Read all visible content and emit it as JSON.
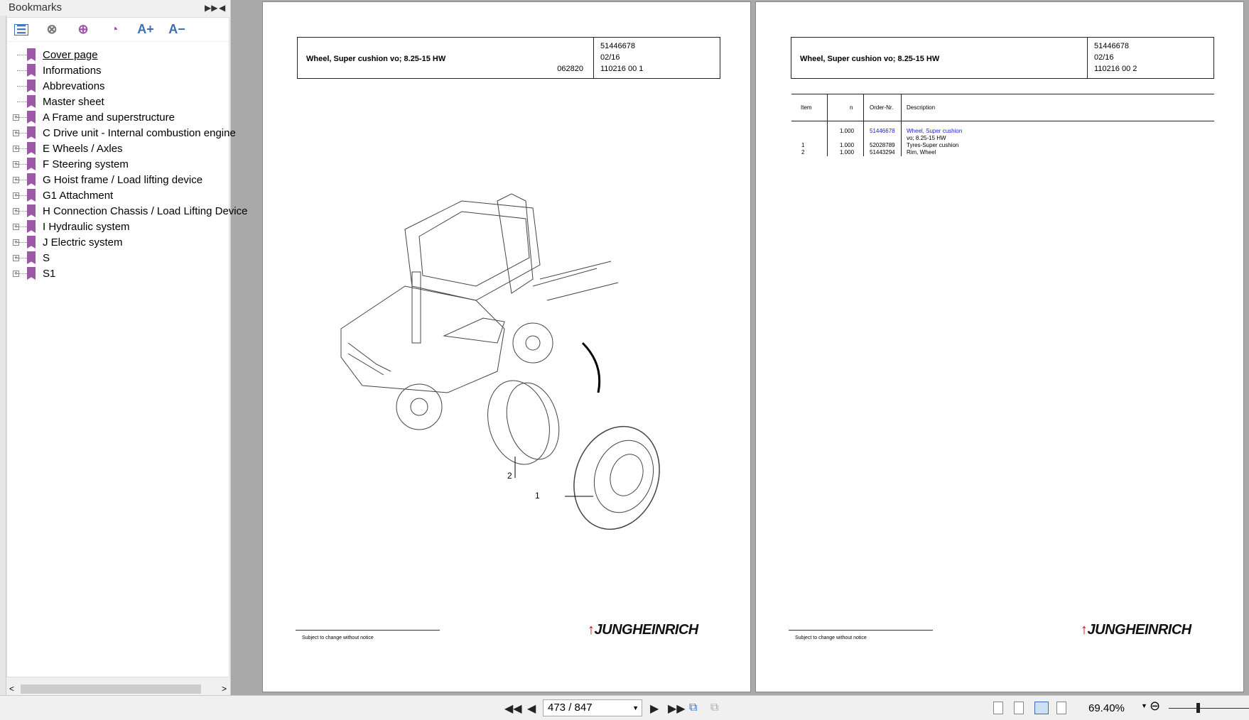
{
  "sidebar": {
    "title": "Bookmarks",
    "items": [
      {
        "label": "Cover page",
        "expandable": false
      },
      {
        "label": "Informations",
        "expandable": false
      },
      {
        "label": "Abbrevations",
        "expandable": false
      },
      {
        "label": "Master sheet",
        "expandable": false
      },
      {
        "label": "A Frame and superstructure",
        "expandable": true
      },
      {
        "label": "C Drive unit - Internal combustion engine",
        "expandable": true
      },
      {
        "label": "E Wheels / Axles",
        "expandable": true
      },
      {
        "label": "F Steering system",
        "expandable": true
      },
      {
        "label": "G Hoist frame / Load lifting device",
        "expandable": true
      },
      {
        "label": "G1 Attachment",
        "expandable": true
      },
      {
        "label": "H Connection Chassis / Load Lifting Device",
        "expandable": true
      },
      {
        "label": "I Hydraulic system",
        "expandable": true
      },
      {
        "label": "J Electric system",
        "expandable": true
      },
      {
        "label": "S",
        "expandable": true
      },
      {
        "label": "S1",
        "expandable": true
      }
    ],
    "tools": {
      "font_up": "A+",
      "font_down": "A−"
    }
  },
  "page1": {
    "title": "Wheel, Super cushion vo; 8.25-15 HW",
    "code": "062820",
    "number": "51446678",
    "date": "02/16",
    "doc": "110216 00 1",
    "callouts": [
      "1",
      "2"
    ],
    "footer": "Subject to change without notice",
    "logo": "JUNGHEINRICH"
  },
  "page2": {
    "title": "Wheel, Super cushion vo; 8.25-15 HW",
    "number": "51446678",
    "date": "02/16",
    "doc": "110216 00 2",
    "table": {
      "headers": [
        "Item",
        "n",
        "Order-Nr.",
        "Description"
      ],
      "rows": [
        {
          "item": "",
          "n": "1.000",
          "order": "51446678",
          "desc": "Wheel, Super cushion",
          "desc2": "vo; 8.25-15 HW"
        },
        {
          "item": "1",
          "n": "1.000",
          "order": "52028789",
          "desc": "Tyres-Super cushion"
        },
        {
          "item": "2",
          "n": "1.000",
          "order": "51443294",
          "desc": "Rim, Wheel"
        }
      ]
    },
    "footer": "Subject to change without notice",
    "logo": "JUNGHEINRICH"
  },
  "toolbar": {
    "page": "473 / 847",
    "zoom": "69.40%"
  },
  "colors": {
    "link": "#2020d0",
    "bookmark": "#9b59a6",
    "brand_red": "#dd0000"
  }
}
